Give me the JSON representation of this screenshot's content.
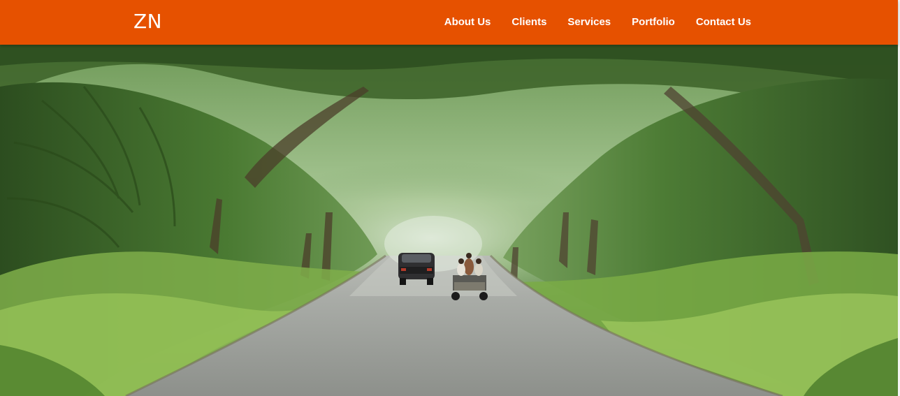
{
  "navbar": {
    "brand": "ZN",
    "links": [
      "About Us",
      "Clients",
      "Services",
      "Portfolio",
      "Contact Us"
    ],
    "background_color": "#e65100",
    "text_color": "#ffffff"
  },
  "hero": {
    "subject": "tree-tunnel-road-photo"
  }
}
